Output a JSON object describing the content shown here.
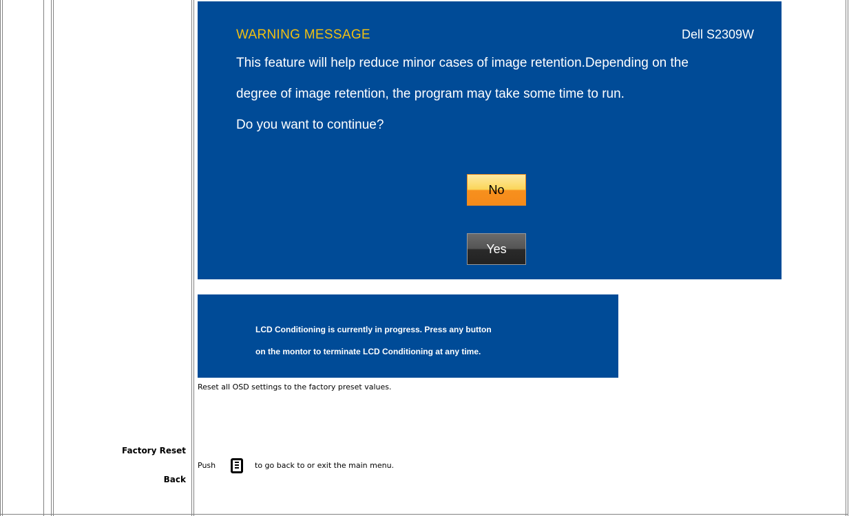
{
  "warning_dialog": {
    "title": "WARNING MESSAGE",
    "model": "Dell S2309W",
    "lines": [
      "This feature will help reduce minor cases of image retention.Depending on the",
      "degree of image retention, the program may take some time to run.",
      "Do you want to continue?"
    ],
    "no_label": "No",
    "yes_label": "Yes"
  },
  "progress_banner": {
    "lines": [
      "LCD Conditioning is currently in progress. Press any button",
      "on the montor to terminate LCD Conditioning at any time."
    ]
  },
  "rows": {
    "factory_reset": {
      "label": "Factory Reset",
      "description": "Reset all OSD settings to the factory preset values."
    },
    "back": {
      "label": "Back",
      "push_word": "Push",
      "description_after_icon": "to go back to or exit the main menu.",
      "icon": "menu-button-icon"
    }
  },
  "colors": {
    "dialog_bg": "#004b97",
    "title_yellow": "#f2c012",
    "no_button": "#f7901e",
    "yes_button": "#2a2a2a"
  }
}
